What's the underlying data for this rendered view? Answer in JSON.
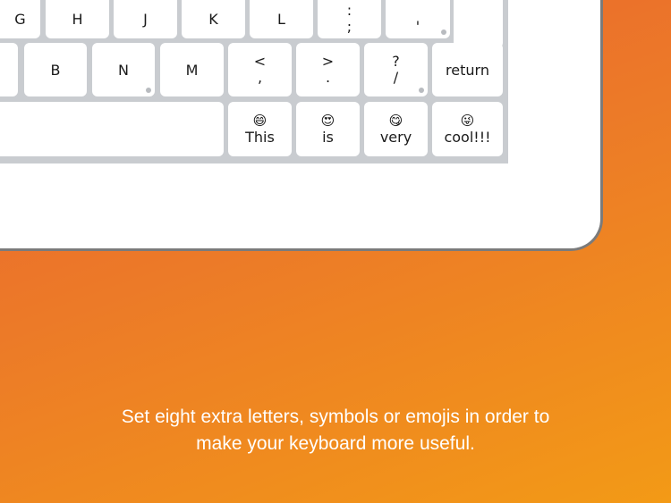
{
  "keyboard": {
    "row1": [
      {
        "label": "G"
      },
      {
        "label": "H"
      },
      {
        "label": "J"
      },
      {
        "label": "K"
      },
      {
        "label": "L"
      },
      {
        "top": ":",
        "bottom": ";"
      },
      {
        "top": "\"",
        "bottom": "'"
      }
    ],
    "row2": [
      {
        "label": "B"
      },
      {
        "label": "N"
      },
      {
        "label": "M"
      },
      {
        "top": "<",
        "bottom": ","
      },
      {
        "top": ">",
        "bottom": "."
      },
      {
        "top": "?",
        "bottom": "/"
      }
    ],
    "return_label": "return",
    "extra_keys": [
      {
        "emoji": "😄",
        "label": "This"
      },
      {
        "emoji": "😍",
        "label": "is"
      },
      {
        "emoji": "😋",
        "label": "very"
      },
      {
        "emoji": "😜",
        "label": "cool!!!"
      }
    ]
  },
  "caption": {
    "line1": "Set eight extra letters, symbols or emojis in order to",
    "line2": "make your keyboard more useful."
  },
  "colors": {
    "background_start": "#e9612f",
    "background_end": "#f39a16",
    "keyboard_bg": "#c9ccd0"
  }
}
